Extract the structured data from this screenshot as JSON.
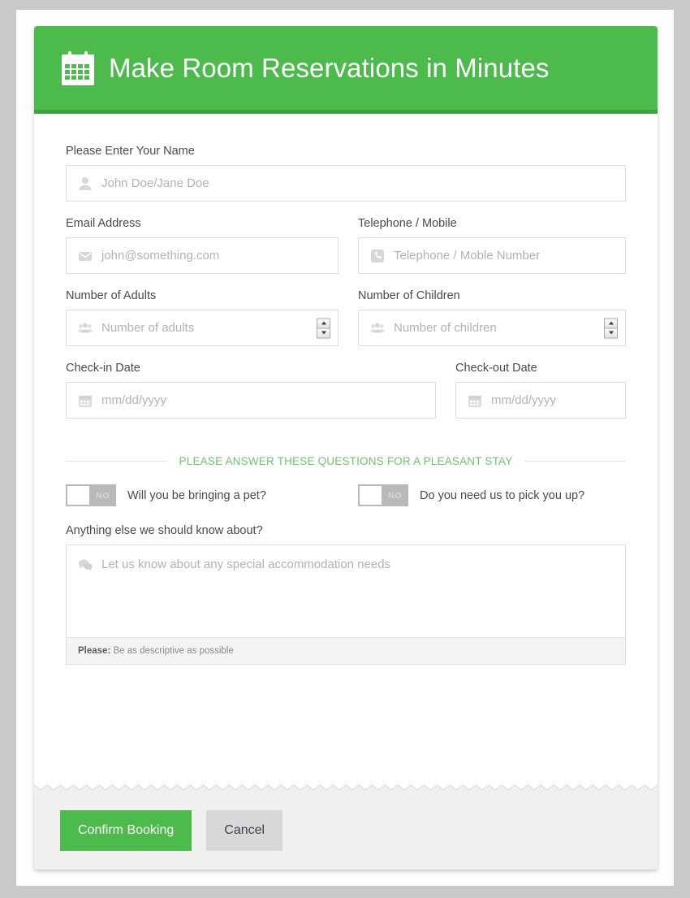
{
  "header": {
    "title": "Make Room Reservations in Minutes",
    "icon": "calendar-icon",
    "bg_color": "#4cbb4c",
    "border_color": "#3ea23e"
  },
  "fields": {
    "name": {
      "label": "Please Enter Your Name",
      "placeholder": "John Doe/Jane Doe",
      "value": "",
      "icon": "user-icon"
    },
    "email": {
      "label": "Email Address",
      "placeholder": "john@something.com",
      "value": "",
      "icon": "envelope-icon"
    },
    "phone": {
      "label": "Telephone / Mobile",
      "placeholder": "Telephone / Moble Number",
      "value": "",
      "icon": "phone-icon"
    },
    "adults": {
      "label": "Number of Adults",
      "placeholder": "Number of adults",
      "value": "",
      "icon": "users-icon"
    },
    "children": {
      "label": "Number of Children",
      "placeholder": "Number of children",
      "value": "",
      "icon": "users-icon"
    },
    "checkin": {
      "label": "Check-in Date",
      "placeholder": "mm/dd/yyyy",
      "value": "",
      "icon": "calendar-icon"
    },
    "checkout": {
      "label": "Check-out Date",
      "placeholder": "mm/dd/yyyy",
      "value": "",
      "icon": "calendar-icon"
    },
    "notes": {
      "label": "Anything else we should know about?",
      "placeholder": "Let us know about any special accommodation needs",
      "value": "",
      "icon": "comments-icon",
      "help_prefix": "Please:",
      "help_text": " Be as descriptive as possible"
    }
  },
  "questions_section": {
    "divider_text": "PLEASE ANSWER THESE QUESTIONS FOR A PLEASANT STAY",
    "divider_color": "#6ec46e",
    "toggles": [
      {
        "state_label": "NO",
        "state": "off",
        "question": "Will you be bringing a pet?"
      },
      {
        "state_label": "NO",
        "state": "off",
        "question": "Do you need us to pick you up?"
      }
    ]
  },
  "footer": {
    "confirm_label": "Confirm Booking",
    "cancel_label": "Cancel",
    "confirm_color": "#4cbb4c",
    "cancel_color": "#d8d8d8"
  }
}
